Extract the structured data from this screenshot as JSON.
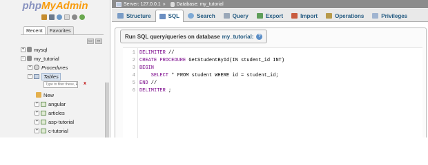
{
  "nav": {
    "logo_php": "php",
    "logo_admin": "MyAdmin",
    "tabs": [
      "Recent",
      "Favorites"
    ],
    "tree": {
      "mysql": "mysql",
      "my_tutorial": "my_tutorial",
      "procedures": "Procedures",
      "tables": "Tables",
      "filter_placeholder": "Type to filter these, E",
      "filter_clear": "x",
      "new": "New",
      "tables_list": [
        "angular",
        "articles",
        "asp-tutorial",
        "c-tutorial"
      ]
    }
  },
  "topbar": {
    "server": "Server: 127.0.0.1",
    "separator": "»",
    "database": "Database: my_tutorial"
  },
  "tabs": [
    {
      "label": "Structure",
      "icon": "structure-icon"
    },
    {
      "label": "SQL",
      "icon": "sql-icon",
      "active": true
    },
    {
      "label": "Search",
      "icon": "search-icon"
    },
    {
      "label": "Query",
      "icon": "query-icon"
    },
    {
      "label": "Export",
      "icon": "export-icon"
    },
    {
      "label": "Import",
      "icon": "import-icon"
    },
    {
      "label": "Operations",
      "icon": "operations-icon"
    },
    {
      "label": "Privileges",
      "icon": "privileges-icon"
    }
  ],
  "sql": {
    "legend_prefix": "Run SQL query/queries on database",
    "legend_db": "my_tutorial:",
    "help": "?",
    "lines": [
      {
        "num": "1",
        "kw": "DELIMITER",
        "rest": " //"
      },
      {
        "num": "2",
        "kw": "CREATE PROCEDURE",
        "rest": " GetStudentById(IN student_id INT)"
      },
      {
        "num": "3",
        "kw": "BEGIN",
        "rest": ""
      },
      {
        "num": "4",
        "kw": "    SELECT",
        "rest": " * FROM student WHERE id = student_id;"
      },
      {
        "num": "5",
        "kw": "END",
        "rest": " //"
      },
      {
        "num": "6",
        "kw": "DELIMITER",
        "rest": " ;"
      }
    ]
  }
}
